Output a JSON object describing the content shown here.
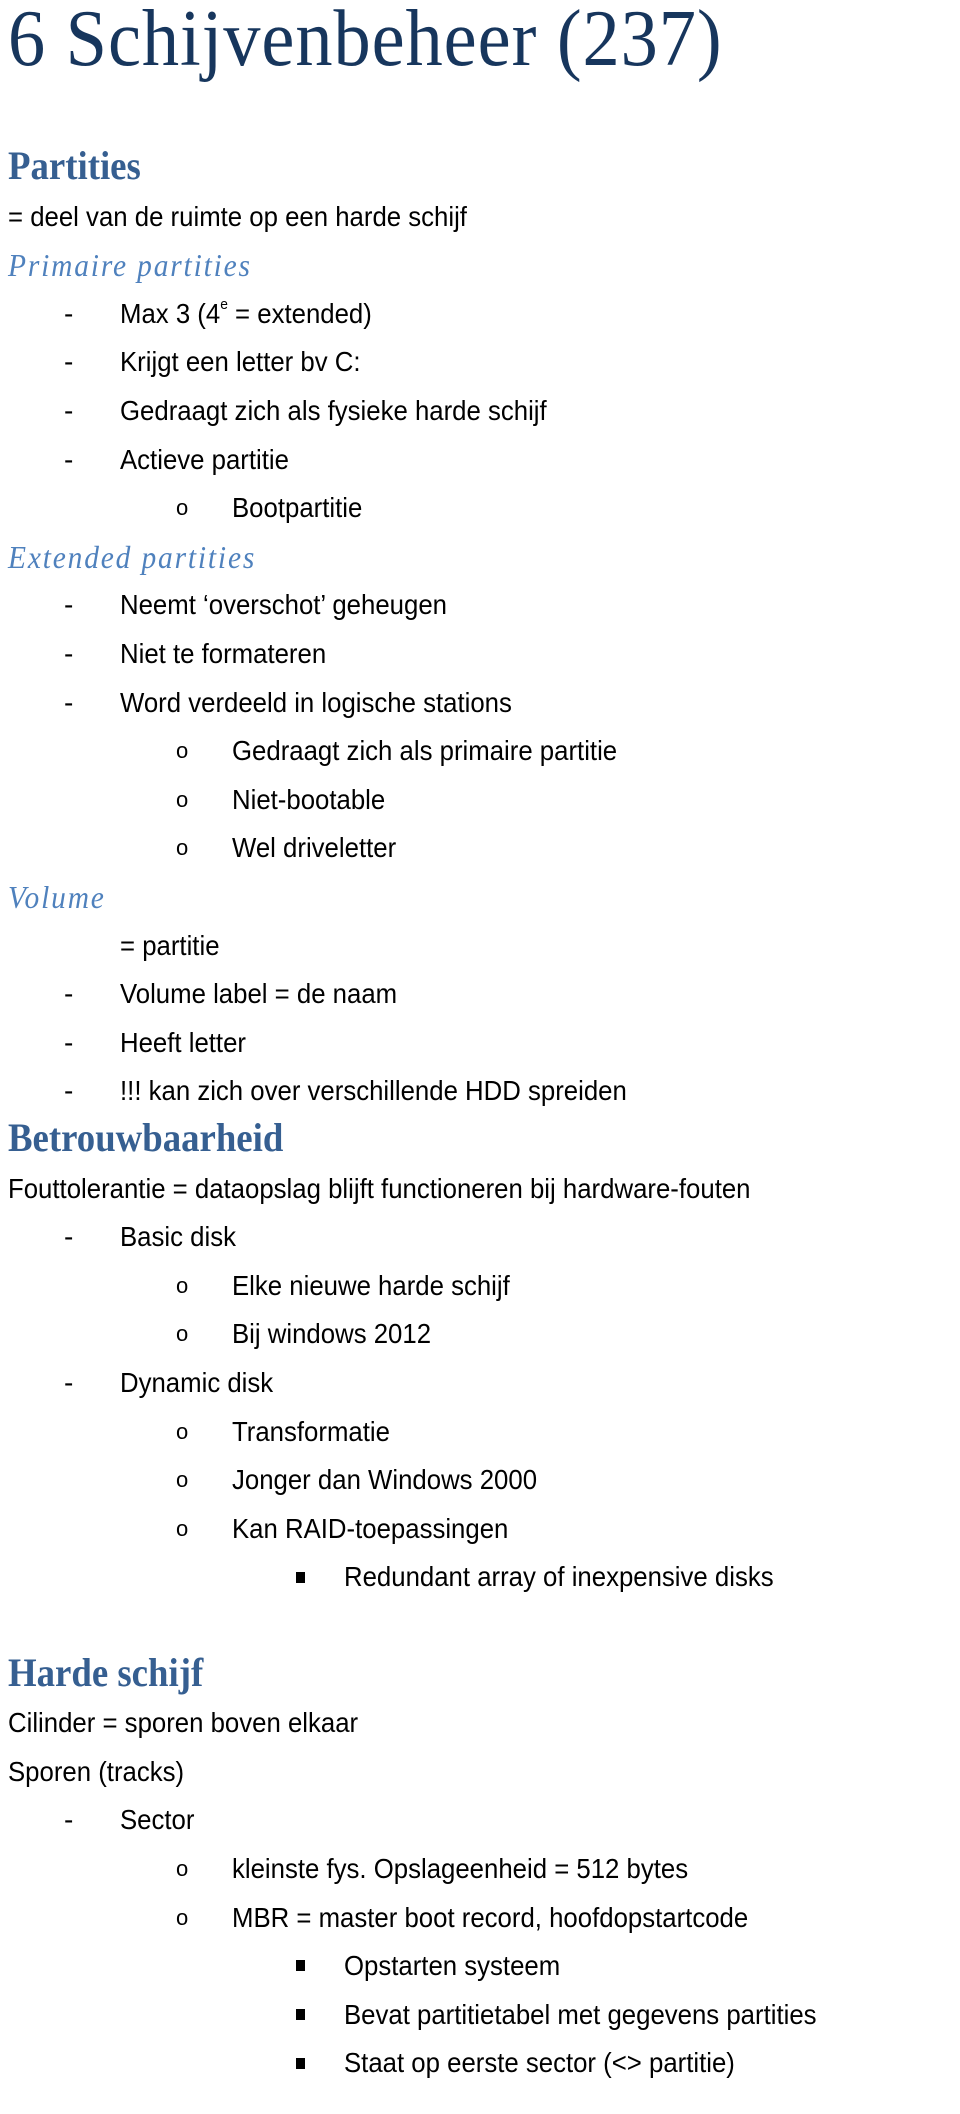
{
  "title": "6 Schijvenbeheer (237)",
  "markers": {
    "dash": "-",
    "circle": "o"
  },
  "lines": [
    {
      "type": "h1",
      "text": "Partities"
    },
    {
      "type": "p",
      "text": "= deel van de ruimte op een harde schijf"
    },
    {
      "type": "h2",
      "text": "Primaire partities"
    },
    {
      "type": "l1",
      "text": "Max 3 (4",
      "sup": "e",
      "after": " = extended)"
    },
    {
      "type": "l1",
      "text": "Krijgt een letter bv C:"
    },
    {
      "type": "l1",
      "text": "Gedraagt zich als fysieke harde schijf"
    },
    {
      "type": "l1",
      "text": "Actieve partitie"
    },
    {
      "type": "l2",
      "text": "Bootpartitie"
    },
    {
      "type": "h2",
      "text": "Extended partities"
    },
    {
      "type": "l1",
      "text": "Neemt ‘overschot’ geheugen"
    },
    {
      "type": "l1",
      "text": "Niet te formateren"
    },
    {
      "type": "l1",
      "text": "Word verdeeld in logische stations"
    },
    {
      "type": "l2",
      "text": "Gedraagt zich als primaire partitie"
    },
    {
      "type": "l2",
      "text": "Niet-bootable"
    },
    {
      "type": "l2",
      "text": "Wel driveletter"
    },
    {
      "type": "h2",
      "text": "Volume"
    },
    {
      "type": "l1c",
      "text": "= partitie"
    },
    {
      "type": "l1",
      "text": "Volume label = de naam"
    },
    {
      "type": "l1",
      "text": "Heeft letter"
    },
    {
      "type": "l1",
      "text": "!!! kan zich over verschillende HDD spreiden"
    },
    {
      "type": "h1",
      "text": "Betrouwbaarheid"
    },
    {
      "type": "p",
      "text": "Fouttolerantie  = dataopslag blijft functioneren bij hardware-fouten"
    },
    {
      "type": "l1",
      "text": "Basic disk"
    },
    {
      "type": "l2",
      "text": "Elke nieuwe harde schijf"
    },
    {
      "type": "l2",
      "text": "Bij windows 2012"
    },
    {
      "type": "l1",
      "text": "Dynamic disk"
    },
    {
      "type": "l2",
      "text": "Transformatie"
    },
    {
      "type": "l2",
      "text": "Jonger dan Windows 2000"
    },
    {
      "type": "l2",
      "text": "Kan RAID-toepassingen"
    },
    {
      "type": "l3",
      "text": "Redundant array of inexpensive disks"
    },
    {
      "type": "gap"
    },
    {
      "type": "h1",
      "text": "Harde schijf"
    },
    {
      "type": "p",
      "text": "Cilinder = sporen boven elkaar"
    },
    {
      "type": "p",
      "text": "Sporen (tracks)"
    },
    {
      "type": "l1",
      "text": "Sector"
    },
    {
      "type": "l2",
      "text": "kleinste fys. Opslageenheid = 512 bytes"
    },
    {
      "type": "l2",
      "text": "MBR = master boot record, hoofdopstartcode"
    },
    {
      "type": "l3",
      "text": "Opstarten systeem"
    },
    {
      "type": "l3",
      "text": "Bevat partitietabel met gegevens partities"
    },
    {
      "type": "l3",
      "text": "Staat op eerste sector (<> partitie)"
    }
  ]
}
